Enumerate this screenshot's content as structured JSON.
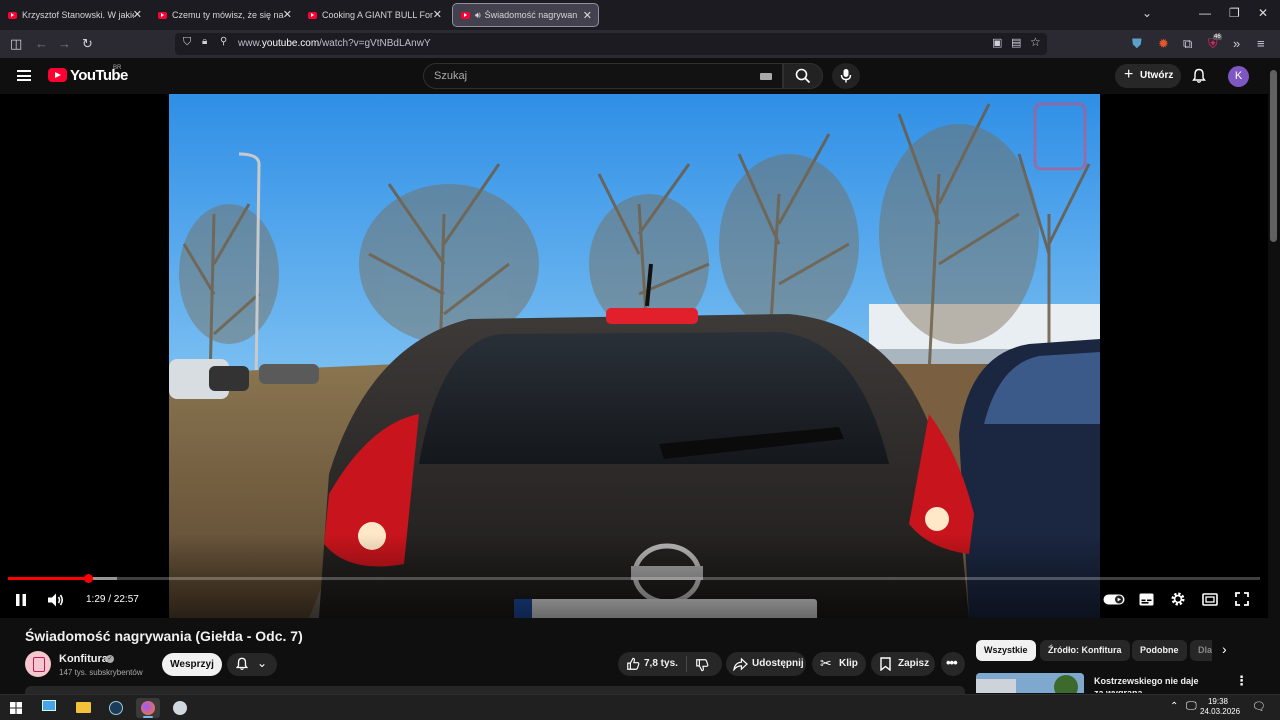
{
  "browser": {
    "tabs": [
      {
        "title": "Krzysztof Stanowski. W jakiej sp"
      },
      {
        "title": "Czemu ty mówisz, że się na ciel"
      },
      {
        "title": "Cooking A GIANT BULL For A G"
      },
      {
        "title": "Świadomość nagrywania (G"
      }
    ],
    "url_prefix": "www.",
    "url_host": "youtube.com",
    "url_path": "/watch?v=gVtNBdLAnwY",
    "extension_badge": "46"
  },
  "youtube": {
    "logo_text": "YouTube",
    "country_code": "BR",
    "search_placeholder": "Szukaj",
    "create_label": "Utwórz",
    "avatar_letter": "K"
  },
  "player": {
    "current_time": "1:29",
    "duration": "22:57",
    "time_display": "1:29 / 22:57",
    "progress_fraction": 0.0646,
    "buffered_fraction": 0.087
  },
  "video": {
    "title": "Świadomość nagrywania (Giełda - Odc. 7)",
    "channel_name": "Konfitura",
    "subscribers": "147 tys. subskrybentów",
    "support_label": "Wesprzyj",
    "likes": "7,8 tys.",
    "share_label": "Udostępnij",
    "clip_label": "Klip",
    "save_label": "Zapisz"
  },
  "recommendations": {
    "chips": [
      "Wszystkie",
      "Źródło: Konfitura",
      "Podobne",
      "Dla"
    ],
    "first_title": "Kostrzewskiego nie daje za wygraną"
  },
  "taskbar": {
    "time": "19:38",
    "date": "24.03.2026"
  },
  "colors": {
    "youtube_red": "#ff0033",
    "progress_red": "#ff0000",
    "avatar_purple": "#7e57c2",
    "background": "#0f0f0f"
  }
}
